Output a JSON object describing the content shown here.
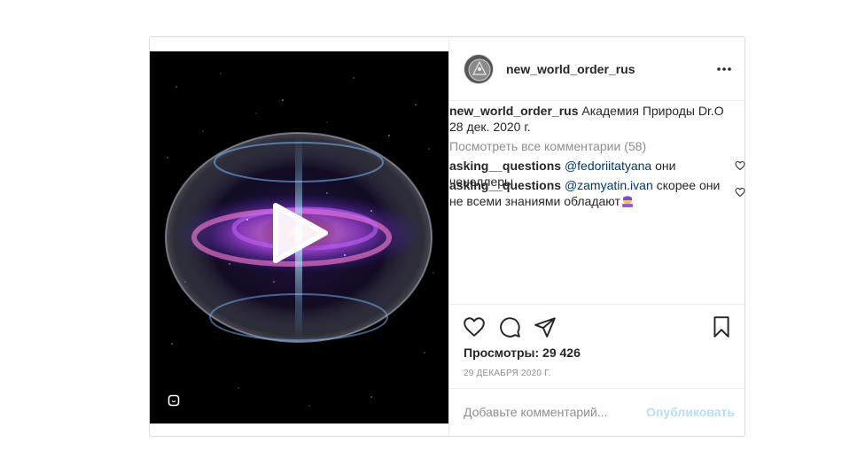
{
  "post": {
    "username": "new_world_order_rus",
    "caption_text": " Академия Природы Dr.O",
    "caption_date": "28 дек. 2020 г.",
    "view_all_comments": "Посмотреть все комментарии (58)",
    "comments": [
      {
        "user": "asking__questions",
        "mention": "@fedoriitatyana",
        "text": " они ченеллеры"
      },
      {
        "user": "asking__questions",
        "mention": "@zamyatin.ivan",
        "text": " скорее они не всеми знаниями обладают"
      }
    ],
    "views": "Просмотры: 29 426",
    "date": "29 декабря 2020 г.",
    "add_comment_placeholder": "Добавьте комментарий...",
    "publish_label": "Опубликовать"
  },
  "icons": {
    "more": "more-options-icon",
    "like": "heart-icon",
    "comment": "comment-bubble-icon",
    "share": "paper-plane-icon",
    "save": "bookmark-icon",
    "play": "play-icon",
    "media_badge": "reels-badge-icon"
  },
  "colors": {
    "mention": "#00376b",
    "secondary_text": "#8e8e8e",
    "publish_disabled": "#b2dffc",
    "border": "#dbdbdb"
  }
}
